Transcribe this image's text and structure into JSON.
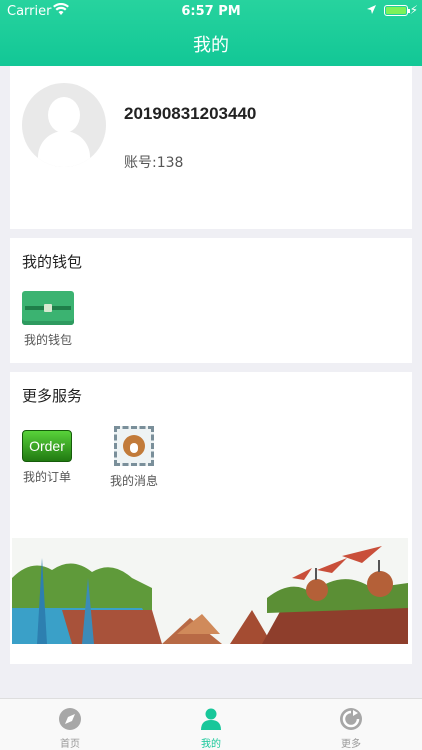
{
  "status_bar": {
    "carrier": "Carrier",
    "time": "6:57 PM"
  },
  "nav": {
    "title": "我的"
  },
  "profile": {
    "username": "20190831203440",
    "account": "账号:138"
  },
  "wallet_section": {
    "title": "我的钱包",
    "items": [
      {
        "label": "我的钱包",
        "icon": "wallet-icon"
      }
    ]
  },
  "services_section": {
    "title": "更多服务",
    "items": [
      {
        "label": "我的订单",
        "icon_text": "Order",
        "icon": "order-icon"
      },
      {
        "label": "我的消息",
        "icon": "message-stamp-icon"
      }
    ]
  },
  "tabbar": {
    "items": [
      {
        "label": "首页",
        "icon": "compass-icon",
        "active": false
      },
      {
        "label": "我的",
        "icon": "user-icon",
        "active": true
      },
      {
        "label": "更多",
        "icon": "refresh-icon",
        "active": false
      }
    ]
  },
  "colors": {
    "accent": "#18c79a",
    "header": "#1ecc9a",
    "background": "#efeff4"
  }
}
